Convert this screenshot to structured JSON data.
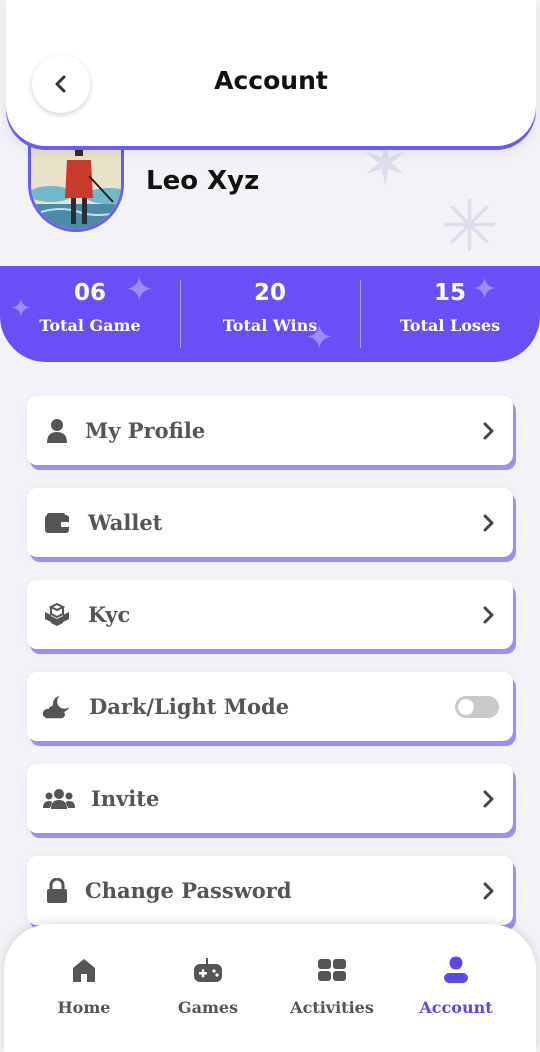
{
  "header": {
    "title": "Account"
  },
  "profile": {
    "name": "Leo Xyz"
  },
  "stats": [
    {
      "value": "06",
      "label": "Total Game"
    },
    {
      "value": "20",
      "label": "Total Wins"
    },
    {
      "value": "15",
      "label": "Total Loses"
    }
  ],
  "menu": [
    {
      "label": "My Profile",
      "icon": "user-icon"
    },
    {
      "label": "Wallet",
      "icon": "wallet-icon"
    },
    {
      "label": "Kyc",
      "icon": "cubes-icon"
    },
    {
      "label": "Dark/Light Mode",
      "icon": "cloud-moon-icon",
      "toggle_on": false
    },
    {
      "label": "Invite",
      "icon": "users-icon"
    },
    {
      "label": "Change Password",
      "icon": "lock-icon"
    }
  ],
  "nav": [
    {
      "label": "Home",
      "icon": "home-icon"
    },
    {
      "label": "Games",
      "icon": "gamepad-icon"
    },
    {
      "label": "Activities",
      "icon": "activities-icon"
    },
    {
      "label": "Account",
      "icon": "account-icon",
      "active": true
    }
  ],
  "colors": {
    "accent": "#6b4ff6",
    "accent_light": "#9b8ff6",
    "active_nav": "#5b48e8",
    "icon_gray": "#555555"
  }
}
